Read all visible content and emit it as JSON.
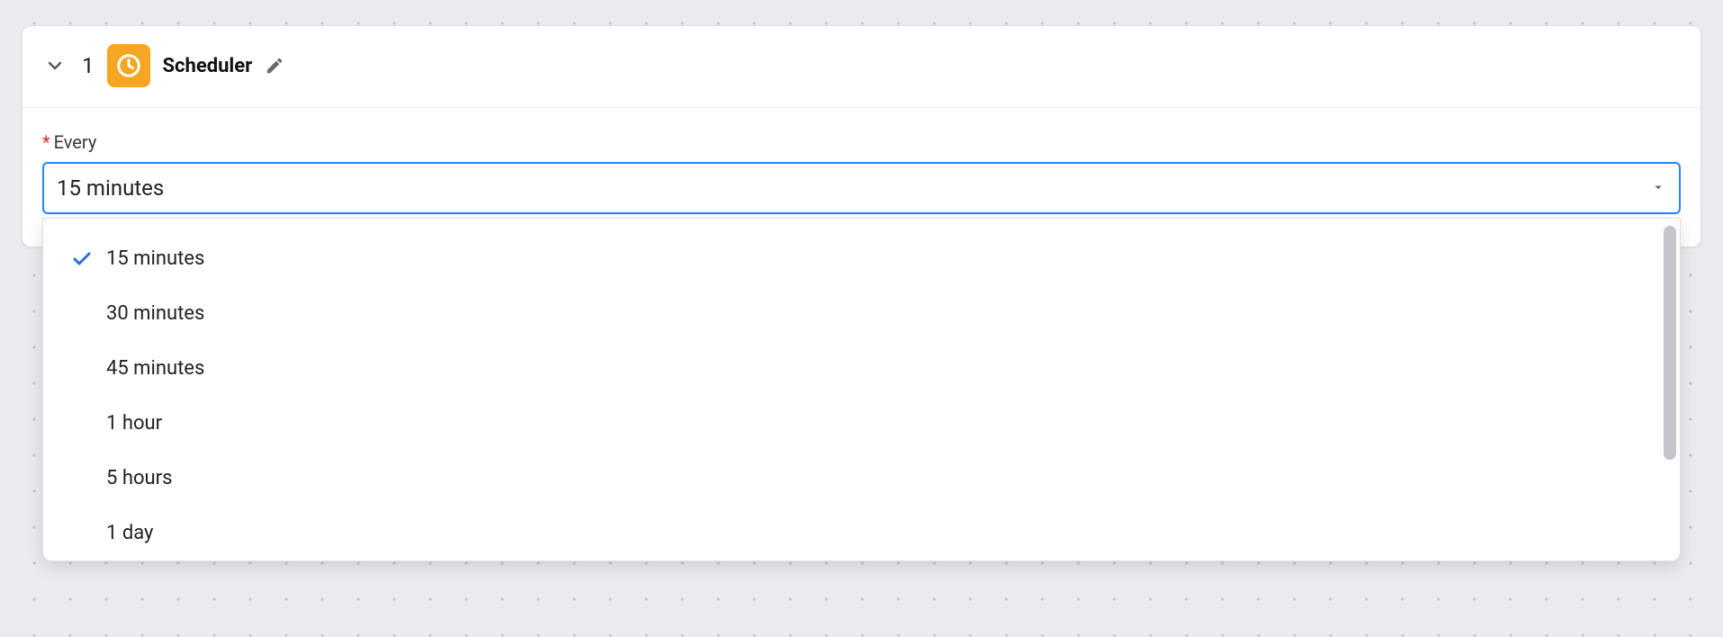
{
  "step": {
    "number": "1",
    "title": "Scheduler"
  },
  "field": {
    "label": "Every",
    "required_mark": "*",
    "selected": "15 minutes",
    "options": [
      {
        "label": "15 minutes",
        "selected": true
      },
      {
        "label": "30 minutes",
        "selected": false
      },
      {
        "label": "45 minutes",
        "selected": false
      },
      {
        "label": "1 hour",
        "selected": false
      },
      {
        "label": "5 hours",
        "selected": false
      },
      {
        "label": "1 day",
        "selected": false
      }
    ]
  }
}
